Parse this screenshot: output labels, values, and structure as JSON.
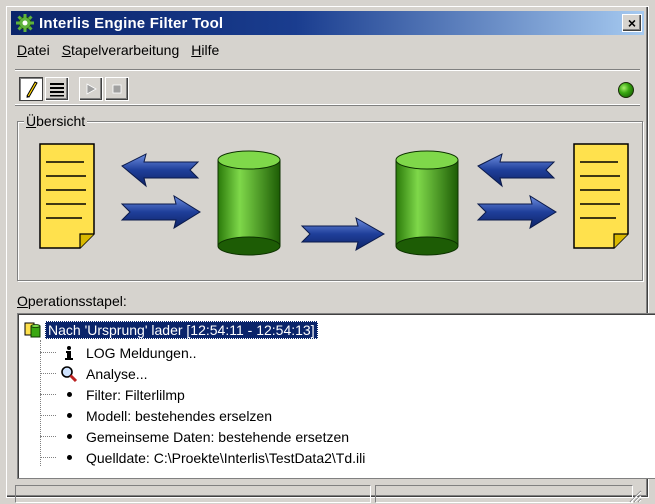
{
  "window": {
    "title": "Interlis Engine  Filter  Tool",
    "close_label": "×"
  },
  "menu": [
    {
      "mnemonic": "D",
      "rest": "atei"
    },
    {
      "mnemonic": "S",
      "rest": "tapelverarbeitung"
    },
    {
      "mnemonic": "H",
      "rest": "ilfe"
    }
  ],
  "toolbar": {
    "buttons": [
      "edit-pencil-icon",
      "list-lines-icon",
      "play-icon",
      "stop-icon"
    ],
    "status_color": "#3aa812"
  },
  "overview": {
    "legend_mnemonic": "Ü",
    "legend_rest": "bersicht"
  },
  "ops": {
    "label_mnemonic": "O",
    "label_rest": "perationsstapel:",
    "root_label": "Nach 'Ursprung' lader [12:54:11 - 12:54:13]",
    "items": [
      {
        "icon": "info-icon",
        "text": "LOG Meldungen.."
      },
      {
        "icon": "magnifier-icon",
        "text": "Analyse..."
      },
      {
        "icon": "bullet",
        "text": "Filter: Filterlilmp"
      },
      {
        "icon": "bullet",
        "text": "Modell: bestehendes erselzen"
      },
      {
        "icon": "bullet",
        "text": "Gemeinseme Daten: bestehende ersetzen"
      },
      {
        "icon": "bullet",
        "text": "Quelldate: C:\\Proekte\\Interlis\\TestData2\\Td.ili"
      }
    ]
  },
  "colors": {
    "selection": "#0a246a",
    "doc_yellow": "#ffe14d",
    "cylinder_green": "#3aa812",
    "arrow_blue": "#1f3f9a"
  }
}
